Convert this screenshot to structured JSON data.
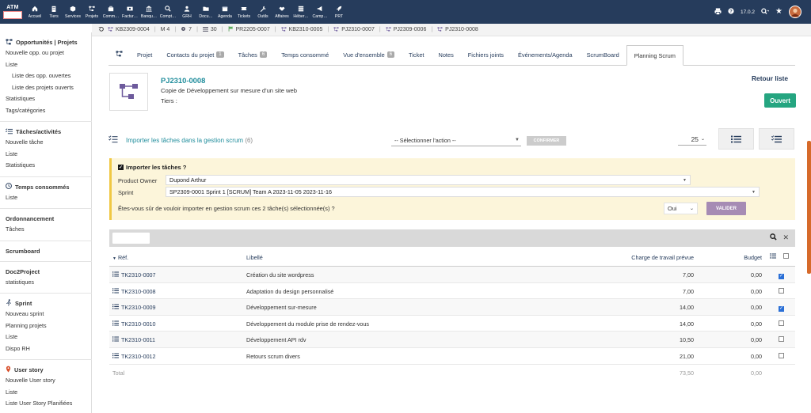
{
  "app": {
    "logo_text": "ATM",
    "version": "17.0.2"
  },
  "topmenu": [
    {
      "label": "Accueil",
      "icon": "home-icon"
    },
    {
      "label": "Tiers",
      "icon": "building-icon"
    },
    {
      "label": "Services",
      "icon": "cube-icon"
    },
    {
      "label": "Projets",
      "icon": "project-icon"
    },
    {
      "label": "Comm…",
      "icon": "briefcase-icon"
    },
    {
      "label": "Factur…",
      "icon": "money-icon"
    },
    {
      "label": "Banqu…",
      "icon": "bank-icon"
    },
    {
      "label": "Compt…",
      "icon": "search-dollar-icon"
    },
    {
      "label": "GRH",
      "icon": "users-icon"
    },
    {
      "label": "Docu…",
      "icon": "folder-icon"
    },
    {
      "label": "Agenda",
      "icon": "calendar-icon"
    },
    {
      "label": "Tickets",
      "icon": "ticket-icon"
    },
    {
      "label": "Outils",
      "icon": "wrench-icon"
    },
    {
      "label": "Affaires",
      "icon": "handshake-icon"
    },
    {
      "label": "Héber…",
      "icon": "server-icon"
    },
    {
      "label": "Camp…",
      "icon": "megaphone-icon"
    },
    {
      "label": "PRT",
      "icon": "rocket-icon"
    }
  ],
  "breadcrumbs": [
    {
      "label": "KB2309-0004"
    },
    {
      "label": "M 4"
    },
    {
      "label": "7"
    },
    {
      "label": "30"
    },
    {
      "label": "PR2205-0007"
    },
    {
      "label": "KB2310-0005"
    },
    {
      "label": "PJ2310-0007"
    },
    {
      "label": "PJ2309-0006"
    },
    {
      "label": "PJ2310-0008"
    }
  ],
  "sidebar": {
    "sections": [
      {
        "title": "Opportunités | Projets",
        "icon": "project-icon",
        "links": [
          {
            "label": "Nouvelle opp. ou projet",
            "sub": false
          },
          {
            "label": "Liste",
            "sub": false
          },
          {
            "label": "Liste des opp. ouvertes",
            "sub": true
          },
          {
            "label": "Liste des projets ouverts",
            "sub": true
          },
          {
            "label": "Statistiques",
            "sub": false
          },
          {
            "label": "Tags/catégories",
            "sub": false
          }
        ]
      },
      {
        "title": "Tâches/activités",
        "icon": "tasks-icon",
        "links": [
          {
            "label": "Nouvelle tâche",
            "sub": false
          },
          {
            "label": "Liste",
            "sub": false
          },
          {
            "label": "Statistiques",
            "sub": false
          }
        ]
      },
      {
        "title": "Temps consommés",
        "icon": "clock-icon",
        "links": [
          {
            "label": "Liste",
            "sub": false
          }
        ]
      },
      {
        "title": "Ordonnancement",
        "icon": "",
        "links": [
          {
            "label": "Tâches",
            "sub": false
          }
        ]
      },
      {
        "title": "Scrumboard",
        "icon": "",
        "links": []
      },
      {
        "title": "Doc2Project",
        "icon": "",
        "links": [
          {
            "label": "statistiques",
            "sub": false
          }
        ]
      },
      {
        "title": "Sprint",
        "icon": "runner-icon",
        "links": [
          {
            "label": "Nouveau sprint",
            "sub": false
          },
          {
            "label": "Planning projets",
            "sub": false
          },
          {
            "label": "Liste",
            "sub": false
          },
          {
            "label": "Dispo RH",
            "sub": false
          }
        ]
      },
      {
        "title": "User story",
        "icon": "pin-icon",
        "links": [
          {
            "label": "Nouvelle User story",
            "sub": false
          },
          {
            "label": "Liste",
            "sub": false
          },
          {
            "label": "Liste User Story Planifiées",
            "sub": false
          }
        ]
      }
    ]
  },
  "tabs": [
    {
      "label": "",
      "icon": "project-icon"
    },
    {
      "label": "Projet"
    },
    {
      "label": "Contacts du projet",
      "badge": "1"
    },
    {
      "label": "Tâches",
      "badge": "6"
    },
    {
      "label": "Temps consommé"
    },
    {
      "label": "Vue d'ensemble",
      "badge": "6"
    },
    {
      "label": "Ticket"
    },
    {
      "label": "Notes"
    },
    {
      "label": "Fichiers joints"
    },
    {
      "label": "Événements/Agenda"
    },
    {
      "label": "ScrumBoard"
    },
    {
      "label": "Planning Scrum",
      "active": true
    }
  ],
  "project": {
    "ref": "PJ2310-0008",
    "description": "Copie de Développement sur mesure d'un site web",
    "tiers_label": "Tiers :",
    "back_label": "Retour liste",
    "status": "Ouvert",
    "status_color": "#25a580"
  },
  "actions": {
    "import_label": "Importer les tâches dans la gestion scrum",
    "import_count": "(6)",
    "select_action": "-- Sélectionner l'action --",
    "confirm_label": "CONFIRMER",
    "per_page": "25"
  },
  "import_box": {
    "title": "Importer les tâches ?",
    "product_owner_label": "Product Owner",
    "product_owner_value": "Dupond Arthur",
    "sprint_label": "Sprint",
    "sprint_value": "SP2309-0001 Sprint 1 [SCRUM] Team A 2023-11-05 2023-11-16",
    "question": "Êtes-vous sûr de vouloir importer en gestion scrum ces 2 tâche(s) sélectionnée(s) ?",
    "answer": "Oui",
    "validate_label": "VALIDER"
  },
  "table": {
    "headers": {
      "ref": "Réf.",
      "label": "Libellé",
      "charge": "Charge de travail prévue",
      "budget": "Budget"
    },
    "rows": [
      {
        "ref": "TK2310-0007",
        "label": "Création du site wordpress",
        "charge": "7,00",
        "budget": "0,00",
        "checked": true
      },
      {
        "ref": "TK2310-0008",
        "label": "Adaptation du design personnalisé",
        "charge": "7,00",
        "budget": "0,00",
        "checked": false
      },
      {
        "ref": "TK2310-0009",
        "label": "Développement sur-mesure",
        "charge": "14,00",
        "budget": "0,00",
        "checked": true
      },
      {
        "ref": "TK2310-0010",
        "label": "Développement du module prise de rendez-vous",
        "charge": "14,00",
        "budget": "0,00",
        "checked": false
      },
      {
        "ref": "TK2310-0011",
        "label": "Développement API rdv",
        "charge": "10,50",
        "budget": "0,00",
        "checked": false
      },
      {
        "ref": "TK2310-0012",
        "label": "Retours scrum divers",
        "charge": "21,00",
        "budget": "0,00",
        "checked": false
      }
    ],
    "total": {
      "label": "Total",
      "charge": "73,50",
      "budget": "0,00"
    }
  }
}
